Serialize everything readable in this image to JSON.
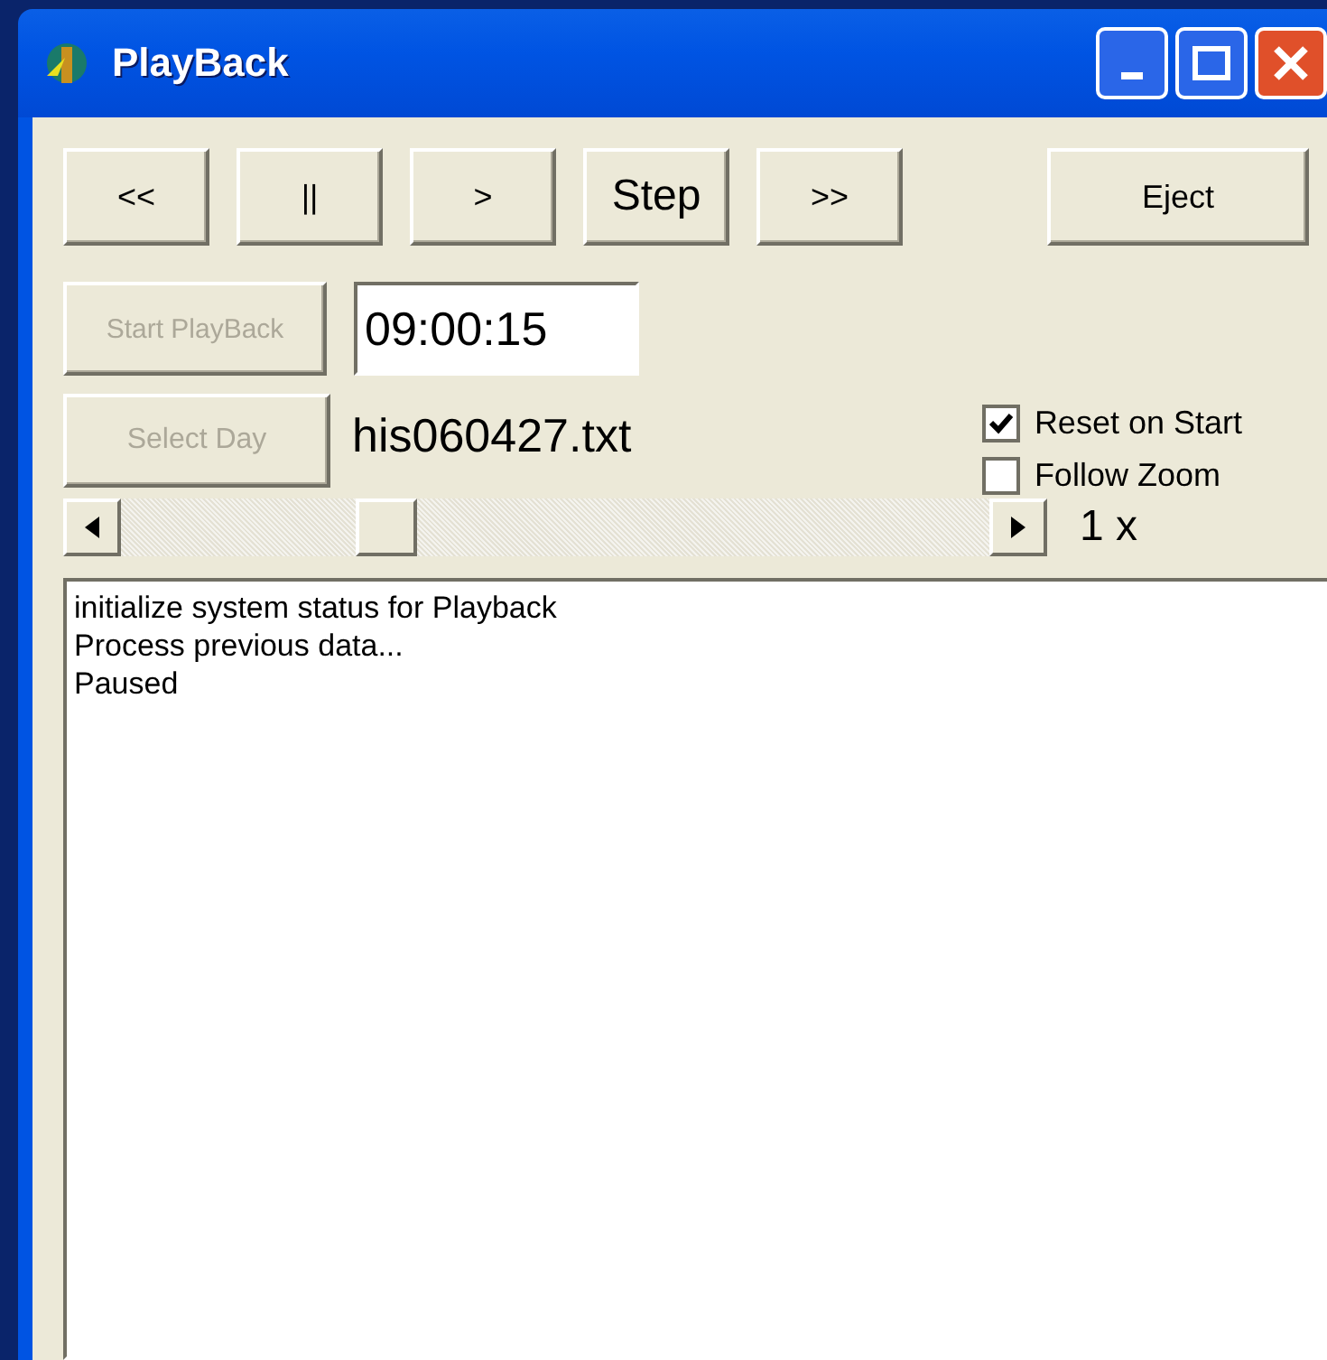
{
  "window": {
    "title": "PlayBack"
  },
  "transport_buttons": [
    {
      "label": "<<",
      "kind": "normal"
    },
    {
      "label": "||",
      "kind": "normal"
    },
    {
      "label": ">",
      "kind": "normal"
    },
    {
      "label": "Step",
      "kind": "large"
    },
    {
      "label": ">>",
      "kind": "normal"
    }
  ],
  "eject_button": {
    "label": "Eject"
  },
  "start_button": {
    "label": "Start PlayBack",
    "disabled": true
  },
  "time_field": {
    "value": "09:00:15"
  },
  "select_day_button": {
    "label": "Select Day",
    "disabled": true
  },
  "file_name": "his060427.txt",
  "options": [
    {
      "label": "Reset on Start",
      "checked": true
    },
    {
      "label": "Follow Zoom",
      "checked": false
    }
  ],
  "speed_slider": {
    "level": 0.29,
    "reading": "1 x"
  },
  "log": [
    "initialize system status for Playback",
    "Process previous data...",
    "Paused"
  ]
}
